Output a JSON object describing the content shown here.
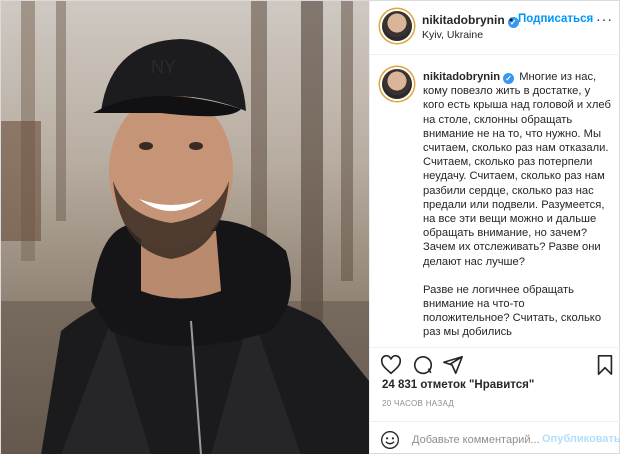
{
  "header": {
    "username": "nikitadobrynin",
    "follow_label": "Подписаться",
    "separator": "•",
    "location": "Kyiv, Ukraine",
    "more_label": "···"
  },
  "caption": {
    "username": "nikitadobrynin",
    "paragraphs": [
      "Многие из нас, кому повезло жить в достатке, у кого есть крыша над головой и хлеб на столе, склонны обращать внимание не на то, что нужно. Мы считаем, сколько раз нам отказали. Считаем, сколько раз потерпели неудачу. Считаем, сколько раз нам разбили сердце, сколько раз нас предали или подвели. Разумеется, на все эти вещи можно и дальше обращать внимание, но зачем? Зачем их отслеживать? Разве они делают нас лучше?",
      "Разве не логичнее обращать внимание на что-то положительное? Считать, сколько раз мы добились"
    ]
  },
  "actions": {
    "icons": [
      "heart-icon",
      "comment-icon",
      "share-icon",
      "bookmark-icon"
    ]
  },
  "likes": "24 831 отметок \"Нравится\"",
  "timestamp": "20 ЧАСОВ НАЗАД",
  "composer": {
    "placeholder": "Добавьте комментарий...",
    "publish_label": "Опубликовать"
  },
  "colors": {
    "accent": "#0095f6",
    "verified": "#3897f0",
    "publish_disabled": "#b2dffc",
    "muted": "#8e8e8e",
    "border": "#efefef"
  }
}
